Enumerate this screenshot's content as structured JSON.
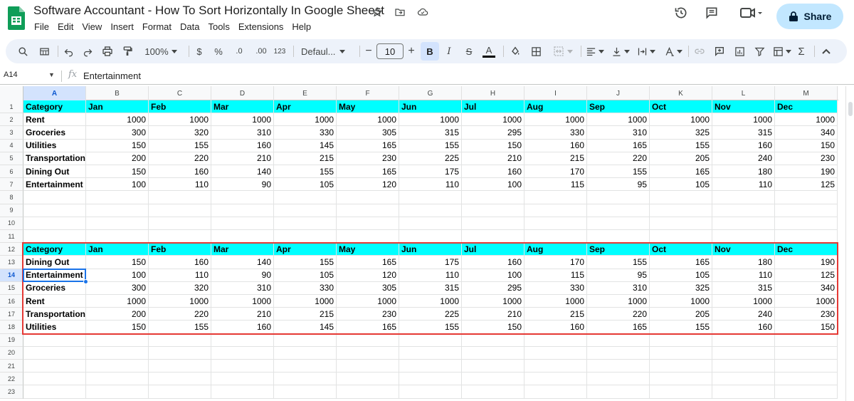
{
  "app": {
    "doc_title": "Software Accountant - How To Sort Horizontally In Google Sheest",
    "menu": [
      "File",
      "Edit",
      "View",
      "Insert",
      "Format",
      "Data",
      "Tools",
      "Extensions",
      "Help"
    ],
    "share_label": "Share",
    "brand_color": "#0f9d58"
  },
  "toolbar": {
    "zoom": "100%",
    "currency": "$",
    "percent": "%",
    "decrease_decimal": ".0",
    "increase_decimal": ".00",
    "number_format": "123",
    "font": "Defaul...",
    "font_size": "10",
    "bold": "B",
    "italic": "I",
    "strike": "S",
    "text_color": "A",
    "sum": "Σ"
  },
  "formula_bar": {
    "name_box": "A14",
    "fx": "fx",
    "content": "Entertainment"
  },
  "columns": [
    "A",
    "B",
    "C",
    "D",
    "E",
    "F",
    "G",
    "H",
    "I",
    "J",
    "K",
    "L",
    "M"
  ],
  "selected_column": "A",
  "selected_row": 14,
  "row_numbers": [
    1,
    2,
    3,
    4,
    5,
    6,
    7,
    8,
    9,
    10,
    11,
    12,
    13,
    14,
    15,
    16,
    17,
    18,
    19,
    20,
    21,
    22,
    23
  ],
  "header_row": [
    "Category",
    "Jan",
    "Feb",
    "Mar",
    "Apr",
    "May",
    "Jun",
    "Jul",
    "Aug",
    "Sep",
    "Oct",
    "Nov",
    "Dec"
  ],
  "table1": [
    [
      "Rent",
      "1000",
      "1000",
      "1000",
      "1000",
      "1000",
      "1000",
      "1000",
      "1000",
      "1000",
      "1000",
      "1000",
      "1000"
    ],
    [
      "Groceries",
      "300",
      "320",
      "310",
      "330",
      "305",
      "315",
      "295",
      "330",
      "310",
      "325",
      "315",
      "340"
    ],
    [
      "Utilities",
      "150",
      "155",
      "160",
      "145",
      "165",
      "155",
      "150",
      "160",
      "165",
      "155",
      "160",
      "150"
    ],
    [
      "Transportation",
      "200",
      "220",
      "210",
      "215",
      "230",
      "225",
      "210",
      "215",
      "220",
      "205",
      "240",
      "230"
    ],
    [
      "Dining Out",
      "150",
      "160",
      "140",
      "155",
      "165",
      "175",
      "160",
      "170",
      "155",
      "165",
      "180",
      "190"
    ],
    [
      "Entertainment",
      "100",
      "110",
      "90",
      "105",
      "120",
      "110",
      "100",
      "115",
      "95",
      "105",
      "110",
      "125"
    ]
  ],
  "table2": [
    [
      "Dining Out",
      "150",
      "160",
      "140",
      "155",
      "165",
      "175",
      "160",
      "170",
      "155",
      "165",
      "180",
      "190"
    ],
    [
      "Entertainment",
      "100",
      "110",
      "90",
      "105",
      "120",
      "110",
      "100",
      "115",
      "95",
      "105",
      "110",
      "125"
    ],
    [
      "Groceries",
      "300",
      "320",
      "310",
      "330",
      "305",
      "315",
      "295",
      "330",
      "310",
      "325",
      "315",
      "340"
    ],
    [
      "Rent",
      "1000",
      "1000",
      "1000",
      "1000",
      "1000",
      "1000",
      "1000",
      "1000",
      "1000",
      "1000",
      "1000",
      "1000"
    ],
    [
      "Transportation",
      "200",
      "220",
      "210",
      "215",
      "230",
      "225",
      "210",
      "215",
      "220",
      "205",
      "240",
      "230"
    ],
    [
      "Utilities",
      "150",
      "155",
      "160",
      "145",
      "165",
      "155",
      "150",
      "160",
      "165",
      "155",
      "160",
      "150"
    ]
  ],
  "colors": {
    "header_fill": "#00ffff",
    "highlight_border": "#e53935",
    "selection": "#1a73e8"
  }
}
